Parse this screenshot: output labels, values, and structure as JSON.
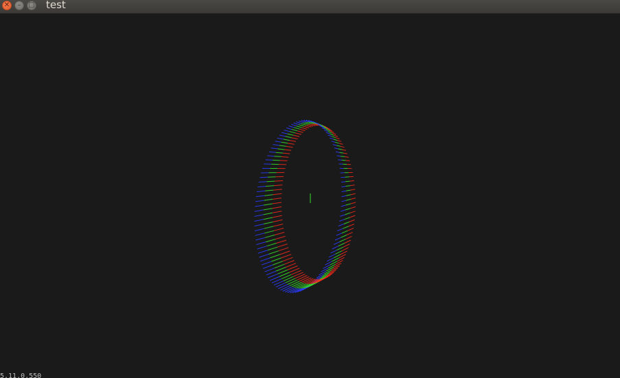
{
  "window": {
    "title": "test",
    "buttons": {
      "close_glyph": "✕",
      "minimize_glyph": "–",
      "maximize_glyph": "□"
    }
  },
  "viewport": {
    "background": "#1a1a1a",
    "scene": "ring-of-normals",
    "colors": {
      "red": "#ff2a1a",
      "green": "#35e02a",
      "blue": "#2a3cff"
    }
  },
  "status": {
    "text": "5.11.0.550"
  }
}
